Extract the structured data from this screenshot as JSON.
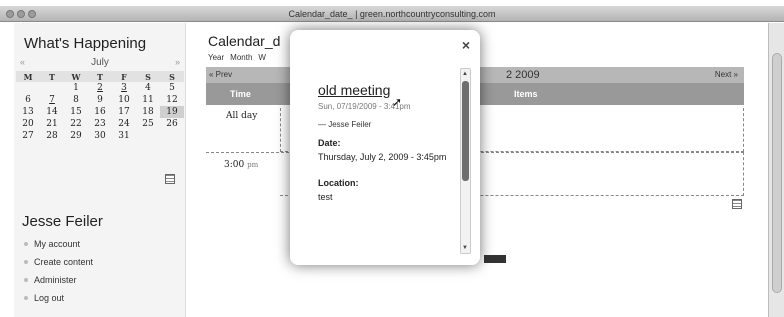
{
  "window": {
    "title": "Calendar_date_ | green.northcountryconsulting.com"
  },
  "sidebar": {
    "heading": "What's Happening",
    "calendar": {
      "month": "July",
      "prev": "«",
      "next": "»",
      "weekdays": [
        "M",
        "T",
        "W",
        "T",
        "F",
        "S",
        "S"
      ],
      "weeks": [
        [
          "",
          "",
          "1",
          "2",
          "3",
          "4",
          "5"
        ],
        [
          "6",
          "7",
          "8",
          "9",
          "10",
          "11",
          "12"
        ],
        [
          "13",
          "14",
          "15",
          "16",
          "17",
          "18",
          "19"
        ],
        [
          "20",
          "21",
          "22",
          "23",
          "24",
          "25",
          "26"
        ],
        [
          "27",
          "28",
          "29",
          "30",
          "31",
          "",
          ""
        ]
      ]
    },
    "user_name": "Jesse Feiler",
    "links": [
      "My account",
      "Create content",
      "Administer",
      "Log out"
    ]
  },
  "main": {
    "title": "Calendar_d",
    "views": [
      "Year",
      "Month",
      "W"
    ],
    "prev": "« Prev",
    "next": "Next »",
    "date_fragment": "2 2009",
    "col_time": "Time",
    "col_items": "Items",
    "allday": "All day",
    "time_slot": "3:00",
    "time_suffix": "pm"
  },
  "popup": {
    "close": "×",
    "title": "old meeting",
    "posted": "Sun, 07/19/2009 - 3:41pm",
    "author": "— Jesse Feiler",
    "date_label": "Date:",
    "date_value": "Thursday, July 2, 2009 - 3:45pm",
    "location_label": "Location:",
    "location_value": "test"
  }
}
